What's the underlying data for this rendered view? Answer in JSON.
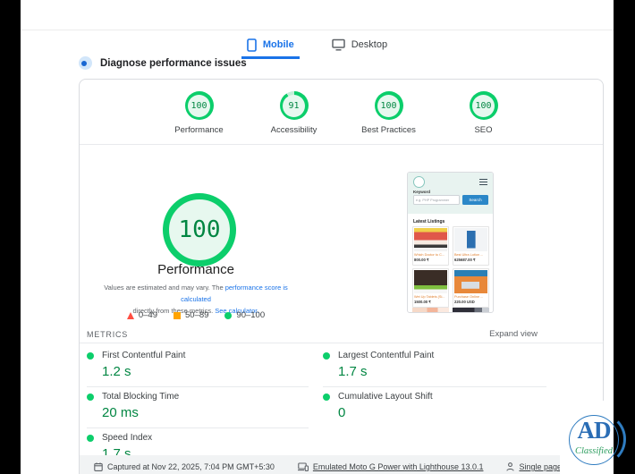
{
  "colors": {
    "green": "#0cce6b",
    "green_dark": "#018642",
    "green_fill": "#e7f8ef",
    "orange": "#ffa400",
    "red": "#ff4e42",
    "blue": "#1a73e8"
  },
  "tabs": {
    "mobile": "Mobile",
    "desktop": "Desktop"
  },
  "diagnose_label": "Diagnose performance issues",
  "categories": [
    {
      "label": "Performance",
      "score": "100"
    },
    {
      "label": "Accessibility",
      "score": "91"
    },
    {
      "label": "Best Practices",
      "score": "100"
    },
    {
      "label": "SEO",
      "score": "100"
    }
  ],
  "gauge": {
    "score": "100",
    "title": "Performance",
    "desc_prefix": "Values are estimated and may vary. The ",
    "desc_link1": "performance score is calculated",
    "desc_middle": "directly from these metrics. ",
    "desc_link2": "See calculator.",
    "legend": [
      {
        "range": "0–49"
      },
      {
        "range": "50–89"
      },
      {
        "range": "90–100"
      }
    ]
  },
  "metrics": {
    "heading": "METRICS",
    "expand": "Expand view",
    "left": [
      {
        "label": "First Contentful Paint",
        "value": "1.2 s"
      },
      {
        "label": "Total Blocking Time",
        "value": "20 ms"
      },
      {
        "label": "Speed Index",
        "value": "1.7 s"
      }
    ],
    "right": [
      {
        "label": "Largest Contentful Paint",
        "value": "1.7 s"
      },
      {
        "label": "Cumulative Layout Shift",
        "value": "0"
      }
    ]
  },
  "capture_bar": {
    "captured": "Captured at Nov 22, 2025, 7:04 PM GMT+5:30",
    "device": "Emulated Moto G Power with Lighthouse 13.0.1",
    "session": "Single page session"
  },
  "screenshot": {
    "keyword_label": "Keyword",
    "search_placeholder": "e.g. PHP Programmer",
    "search_button": "Search",
    "listings_heading": "Latest Listings",
    "cards": [
      {
        "title": "Which Doctor to C...",
        "price": "800.00 ₹"
      },
      {
        "title": "Best Ultra Lotion ...",
        "price": "625687.00 ₹"
      },
      {
        "title": "Wet Up Tablets (Si...",
        "price": "1500.00 ₹"
      },
      {
        "title": "Purchase Online ...",
        "price": "220.00 USD"
      }
    ]
  },
  "watermark": {
    "ad": "AD",
    "classified": "Classified"
  }
}
